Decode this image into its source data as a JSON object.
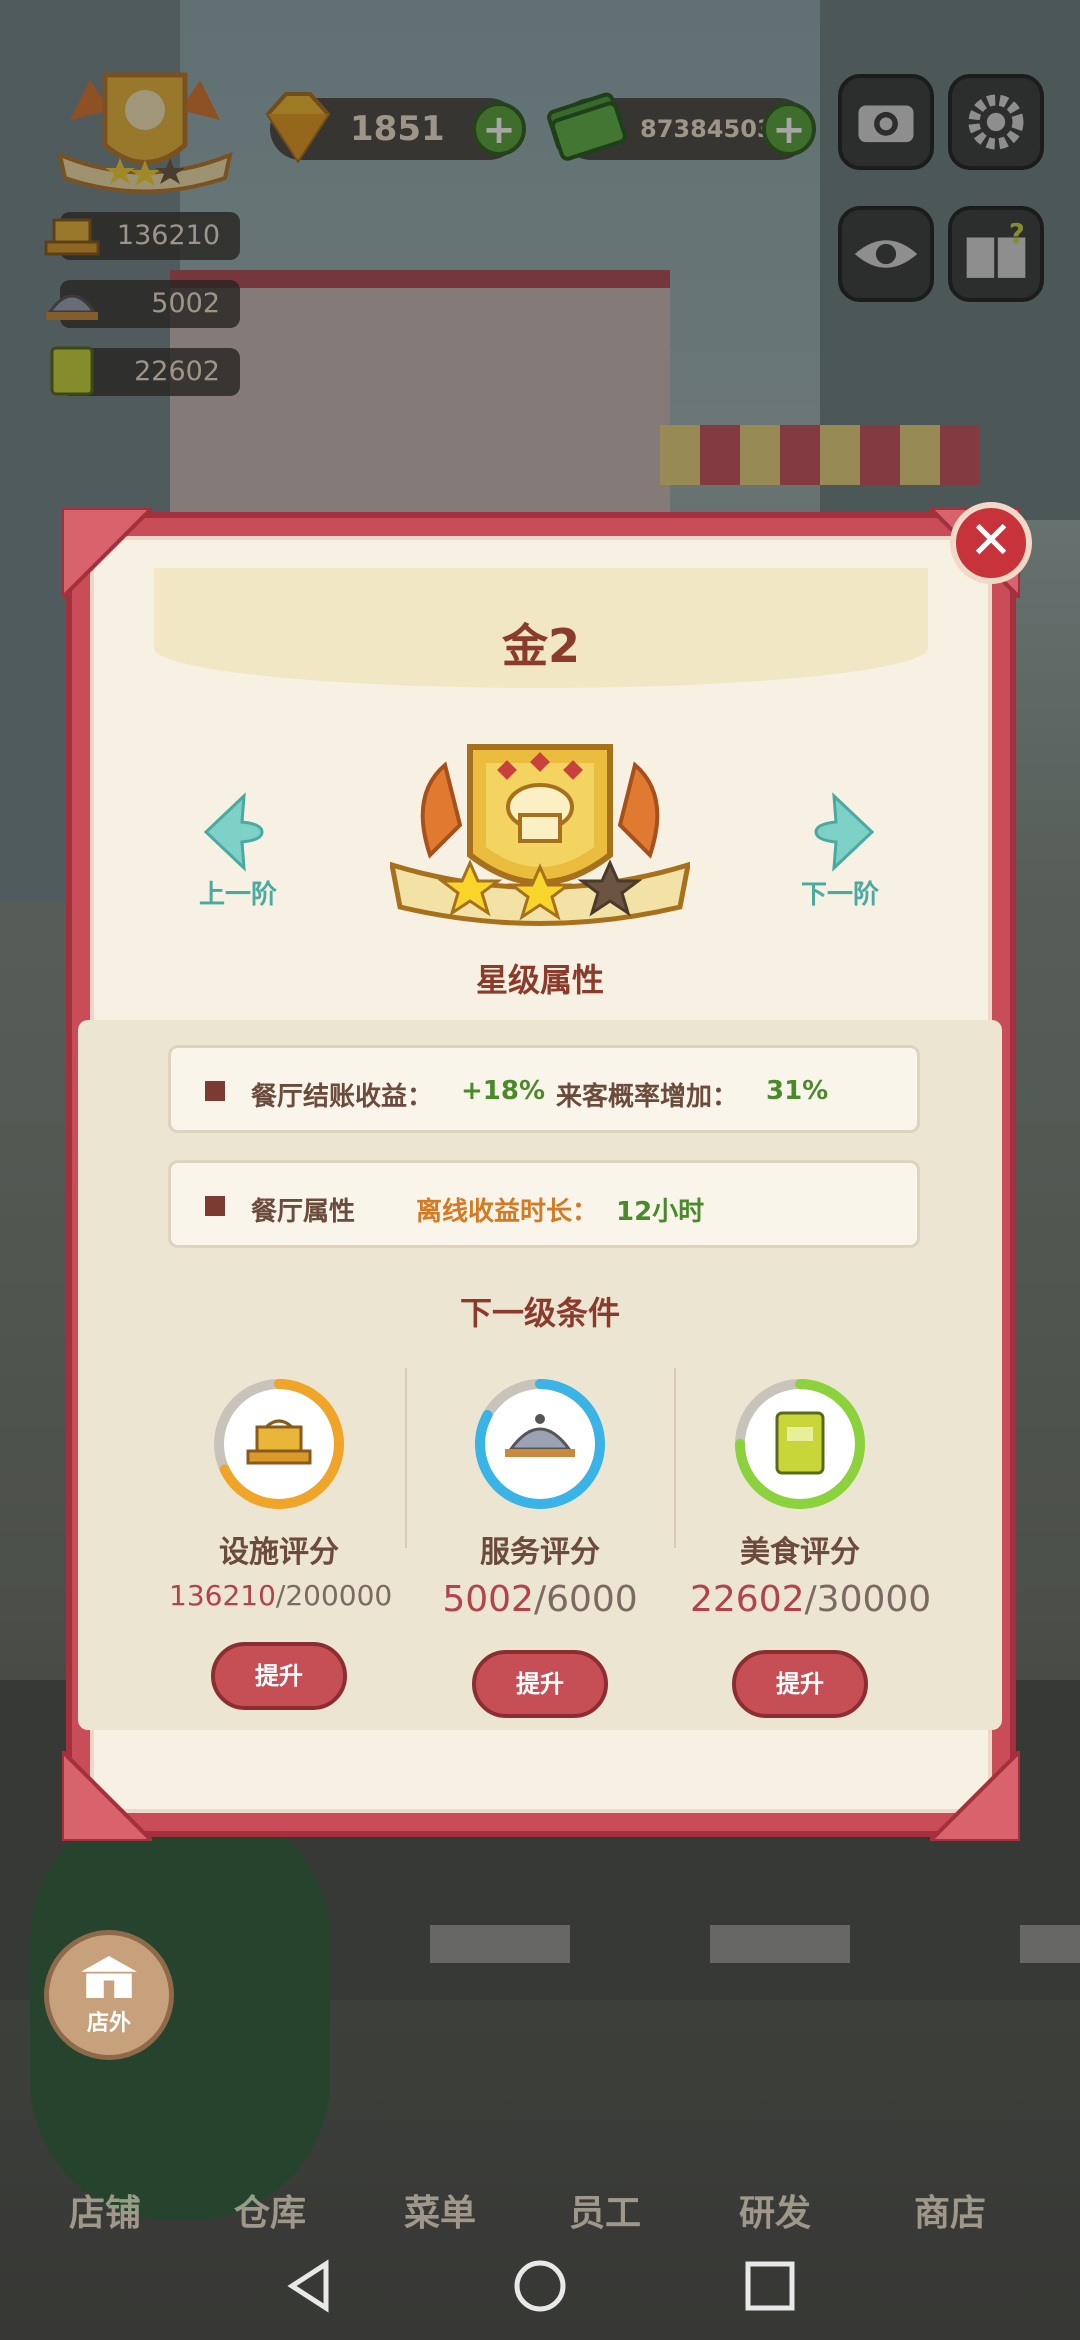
{
  "hud": {
    "gems": "1851",
    "cash": "87384503",
    "facility_score": "136210",
    "service_score": "5002",
    "food_score": "22602"
  },
  "dialog": {
    "title": "金2",
    "prev_label": "上一阶",
    "next_label": "下一阶",
    "close_icon": "✕",
    "star_section_title": "星级属性",
    "attr1": {
      "label": "餐厅结账收益：",
      "value": "+18%",
      "label2": "来客概率增加：",
      "value2": "31%"
    },
    "attr2": {
      "label": "餐厅属性",
      "label2": "离线收益时长：",
      "value2": "12小时"
    },
    "next_conditions_title": "下一级条件",
    "scores": [
      {
        "label": "设施评分",
        "current": "136210",
        "target": "/200000",
        "progress": 0.68,
        "color": "#f0a528",
        "button": "提升"
      },
      {
        "label": "服务评分",
        "current": "5002",
        "target": "/6000",
        "progress": 0.83,
        "color": "#3ab4e6",
        "button": "提升"
      },
      {
        "label": "美食评分",
        "current": "22602",
        "target": "/30000",
        "progress": 0.75,
        "color": "#8cd23c",
        "button": "提升"
      }
    ],
    "stars_filled": 2,
    "stars_total": 3
  },
  "bottom": {
    "outside_label": "店外",
    "tabs": [
      "店铺",
      "仓库",
      "菜单",
      "员工",
      "研发",
      "商店"
    ]
  }
}
